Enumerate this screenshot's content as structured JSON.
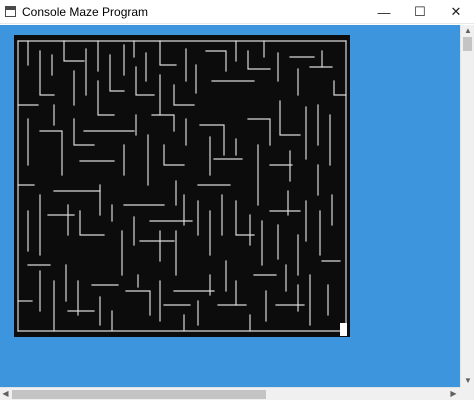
{
  "window": {
    "title": "Console Maze Program",
    "app_icon": "console-window-icon",
    "controls": {
      "minimize_glyph": "—",
      "maximize_glyph": "☐",
      "close_glyph": "✕"
    }
  },
  "colors": {
    "client_background": "#3d96dd",
    "maze_background": "#0c0c0c",
    "maze_walls": "#d9d9d9",
    "scrollbar_track": "#f0f0f0",
    "scrollbar_thumb": "#c4c4c4"
  },
  "scrollbars": {
    "vertical": {
      "up_glyph": "▲",
      "down_glyph": "▼"
    },
    "horizontal": {
      "left_glyph": "◀",
      "right_glyph": "▶"
    }
  },
  "maze": {
    "exit_marker": "end-cursor-block"
  }
}
